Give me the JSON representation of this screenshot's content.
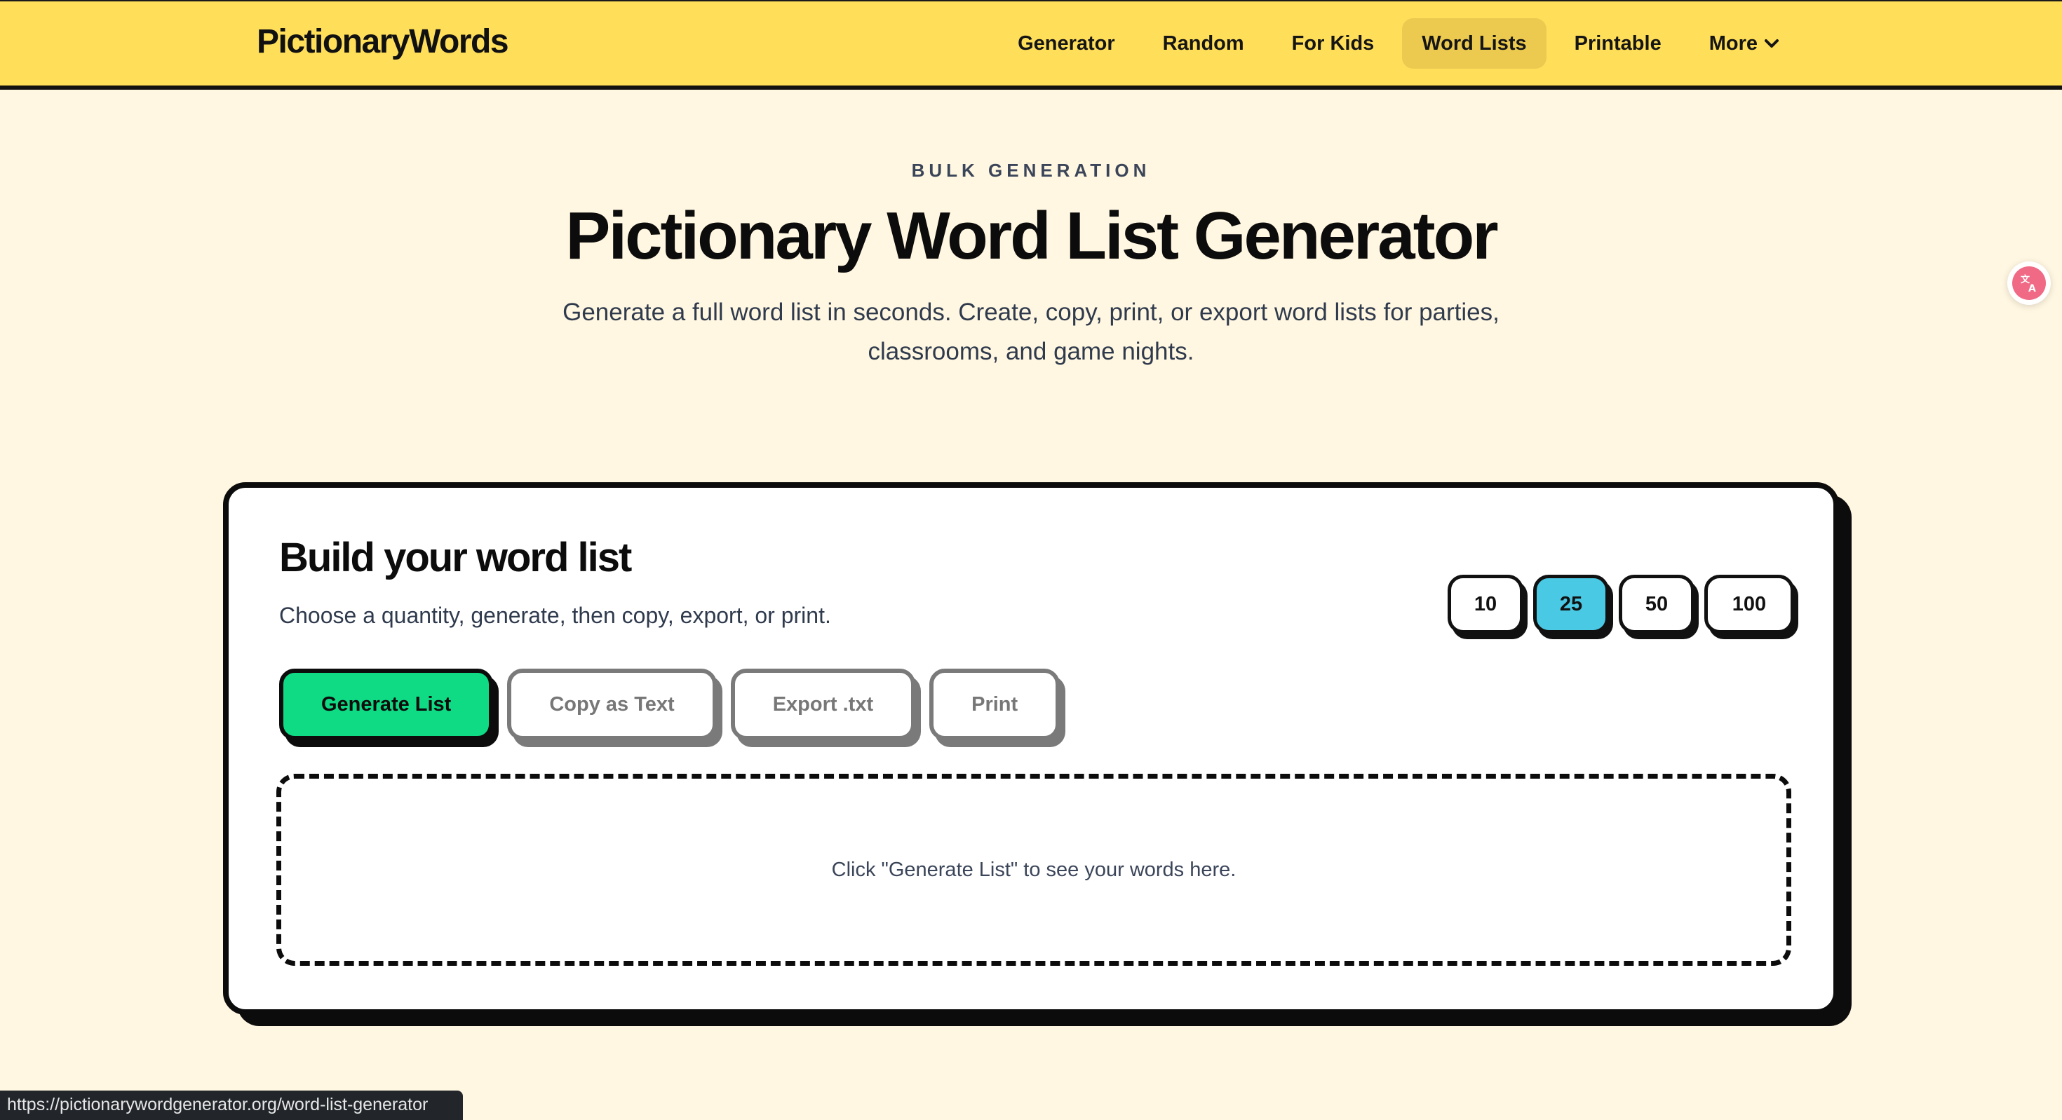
{
  "header": {
    "logo": "PictionaryWords",
    "nav": [
      {
        "label": "Generator"
      },
      {
        "label": "Random"
      },
      {
        "label": "For Kids"
      },
      {
        "label": "Word Lists",
        "active": true
      },
      {
        "label": "Printable"
      },
      {
        "label": "More"
      }
    ]
  },
  "hero": {
    "eyebrow": "BULK GENERATION",
    "title": "Pictionary Word List Generator",
    "subtitle": "Generate a full word list in seconds. Create, copy, print, or export word lists for parties, classrooms, and game nights."
  },
  "card": {
    "title": "Build your word list",
    "subtitle": "Choose a quantity, generate, then copy, export, or print.",
    "quantities": [
      "10",
      "25",
      "50",
      "100"
    ],
    "selected_quantity": "25",
    "buttons": {
      "generate": "Generate List",
      "copy": "Copy as Text",
      "export": "Export .txt",
      "print": "Print"
    },
    "empty_state": "Click \"Generate List\" to see your words here."
  },
  "status_bar": {
    "url": "https://pictionarywordgenerator.org/word-list-generator"
  },
  "floating": {
    "translate_icon": "translate-icon"
  },
  "colors": {
    "header_bg": "#ffde5a",
    "page_bg": "#fff7e1",
    "primary_button": "#0fdb84",
    "selected_quantity": "#49c9e4",
    "nav_active": "#ecc94f"
  }
}
